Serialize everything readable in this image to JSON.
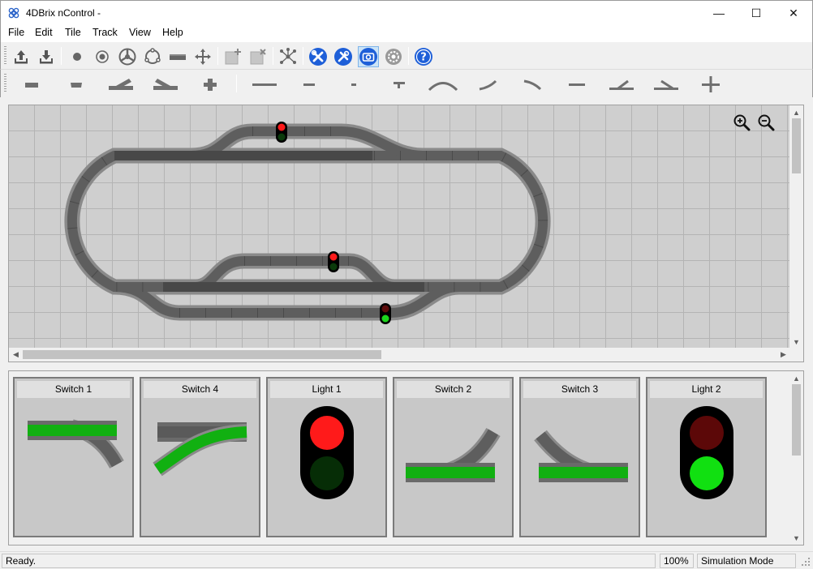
{
  "window": {
    "title": "4DBrix nControl -",
    "minimize_glyph": "—",
    "maximize_glyph": "☐",
    "close_glyph": "✕"
  },
  "menu": {
    "items": [
      {
        "label": "File",
        "icon": "none"
      },
      {
        "label": "Edit",
        "icon": "none"
      },
      {
        "label": "Tile",
        "icon": "none"
      },
      {
        "label": "Track",
        "icon": "none"
      },
      {
        "label": "View",
        "icon": "none"
      },
      {
        "label": "Help",
        "icon": "none"
      }
    ]
  },
  "toolbar_primary": {
    "buttons": [
      {
        "name": "upload-icon",
        "state": "enabled"
      },
      {
        "name": "download-icon",
        "state": "enabled"
      },
      {
        "name": "dot-icon",
        "state": "enabled"
      },
      {
        "name": "target-dot-icon",
        "state": "enabled"
      },
      {
        "name": "turntable-icon",
        "state": "enabled"
      },
      {
        "name": "loop-icon",
        "state": "enabled"
      },
      {
        "name": "rail-piece-icon",
        "state": "enabled"
      },
      {
        "name": "cross-arrows-icon",
        "state": "enabled"
      },
      {
        "name": "add-tile-icon",
        "state": "disabled"
      },
      {
        "name": "delete-tile-icon",
        "state": "disabled"
      },
      {
        "name": "network-icon",
        "state": "enabled"
      },
      {
        "name": "tools-icon",
        "state": "enabled"
      },
      {
        "name": "wrench-icon",
        "state": "enabled"
      },
      {
        "name": "camera-icon",
        "state": "pressed"
      },
      {
        "name": "gear-icon",
        "state": "enabled"
      },
      {
        "name": "help-icon",
        "state": "enabled"
      }
    ],
    "accent_color": "#1e5fd8"
  },
  "toolbar_tiles": {
    "buttons": [
      {
        "name": "straight-tile-icon"
      },
      {
        "name": "short-straight-tile-icon"
      },
      {
        "name": "switch-left-tile-icon"
      },
      {
        "name": "switch-right-tile-icon"
      },
      {
        "name": "cross-tile-icon"
      },
      {
        "name": "track-long-icon"
      },
      {
        "name": "track-medium-icon"
      },
      {
        "name": "track-short-icon"
      },
      {
        "name": "track-end-icon"
      },
      {
        "name": "track-curve-icon"
      },
      {
        "name": "track-curve-left-icon"
      },
      {
        "name": "track-curve-right-icon"
      },
      {
        "name": "track-straight-icon"
      },
      {
        "name": "track-switch-left-icon"
      },
      {
        "name": "track-switch-right-icon"
      },
      {
        "name": "track-cross-icon"
      }
    ]
  },
  "layout_canvas": {
    "zoom_in_icon": "zoom-in-icon",
    "zoom_out_icon": "zoom-out-icon",
    "track_color": "#6f6f6f",
    "signals": [
      {
        "name": "signal-top",
        "lit": "red"
      },
      {
        "name": "signal-middle",
        "lit": "red"
      },
      {
        "name": "signal-bottom",
        "lit": "green"
      }
    ]
  },
  "control_panel": {
    "cards": [
      {
        "title": "Switch 1",
        "type": "switch",
        "variant": "straight-top-diverge-down-right"
      },
      {
        "title": "Switch 4",
        "type": "switch",
        "variant": "diverge-up-active"
      },
      {
        "title": "Light 1",
        "type": "light",
        "lit": "red"
      },
      {
        "title": "Switch 2",
        "type": "switch",
        "variant": "straight-bottom-diverge-up-right"
      },
      {
        "title": "Switch 3",
        "type": "switch",
        "variant": "straight-bottom-diverge-up-left"
      },
      {
        "title": "Light 2",
        "type": "light",
        "lit": "green"
      }
    ],
    "active_color": "#11b011"
  },
  "status": {
    "message": "Ready.",
    "zoom": "100%",
    "mode": "Simulation Mode"
  }
}
